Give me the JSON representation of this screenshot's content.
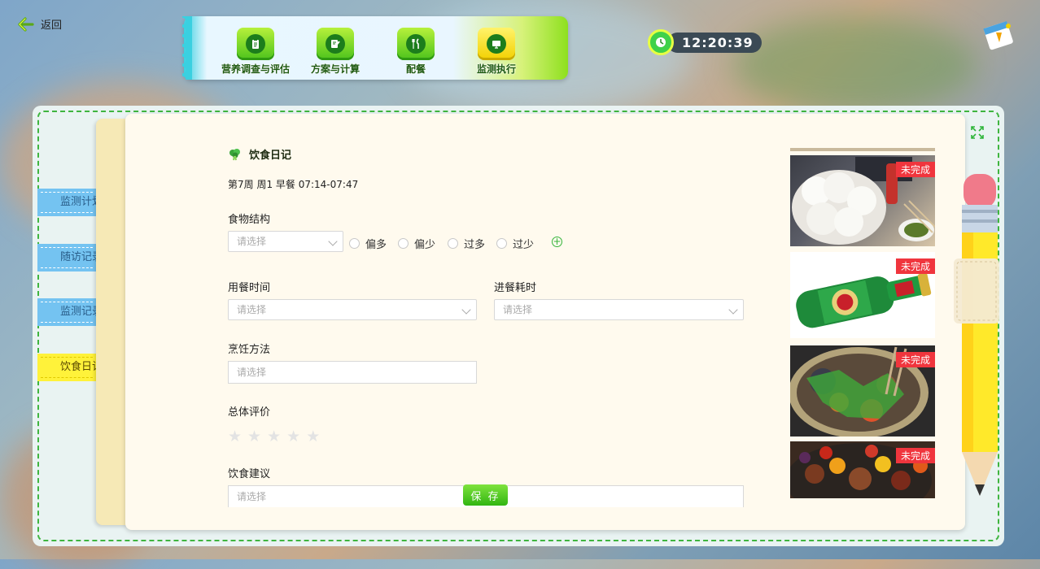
{
  "header": {
    "back_label": "返回",
    "clock_time": "12:20:39"
  },
  "nav": {
    "items": [
      {
        "label": "营养调查与评估",
        "icon": "clipboard-icon"
      },
      {
        "label": "方案与计算",
        "icon": "edit-document-icon"
      },
      {
        "label": "配餐",
        "icon": "fork-knife-icon"
      },
      {
        "label": "监测执行",
        "icon": "monitor-icon"
      }
    ],
    "active_index": 3
  },
  "side_tabs": {
    "items": [
      "监测计划",
      "随访记录",
      "监测记录",
      "饮食日记"
    ],
    "active_index": 3
  },
  "form": {
    "title": "饮食日记",
    "meal_info": "第7周 周1 早餐 07:14-07:47",
    "food_structure": {
      "label": "食物结构",
      "placeholder": "请选择",
      "options": [
        "偏多",
        "偏少",
        "过多",
        "过少"
      ]
    },
    "meal_time": {
      "label": "用餐时间",
      "placeholder": "请选择"
    },
    "eating_duration": {
      "label": "进餐耗时",
      "placeholder": "请选择"
    },
    "cooking_method": {
      "label": "烹饪方法",
      "placeholder": "请选择"
    },
    "overall_rating": {
      "label": "总体评价",
      "value": 0,
      "max": 5
    },
    "diet_advice": {
      "label": "饮食建议",
      "placeholder": "请选择"
    },
    "save_label": "保 存"
  },
  "photos": [
    {
      "status": "未完成",
      "subject": "steamed-buns"
    },
    {
      "status": "未完成",
      "subject": "beer-bottle"
    },
    {
      "status": "未完成",
      "subject": "stew-bowl"
    },
    {
      "status": "未完成",
      "subject": "meat-vegetables"
    }
  ],
  "colors": {
    "accent_green": "#35b43a",
    "tab_blue": "#74c3f1",
    "tab_active_yellow": "#fff23a",
    "status_red": "#f0353d",
    "paper": "#fffaee"
  }
}
